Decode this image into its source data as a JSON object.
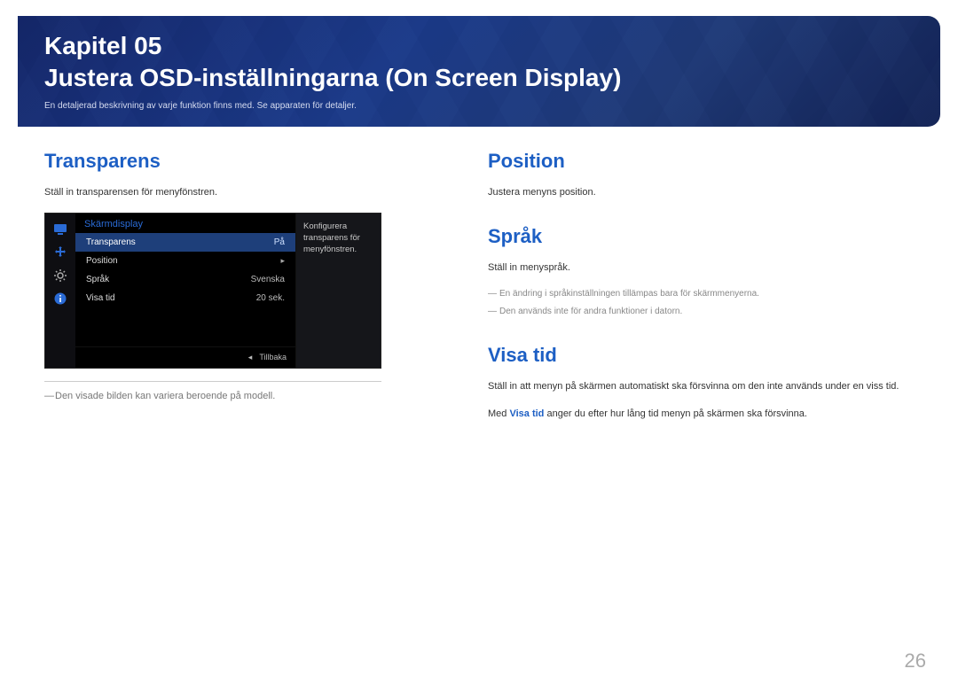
{
  "banner": {
    "chapter": "Kapitel 05",
    "title": "Justera OSD-inställningarna (On Screen Display)",
    "subtitle": "En detaljerad beskrivning av varje funktion finns med. Se apparaten för detaljer."
  },
  "left": {
    "heading": "Transparens",
    "desc": "Ställ in transparensen för menyfönstren.",
    "osd": {
      "header": "Skärmdisplay",
      "rows": [
        {
          "label": "Transparens",
          "value": "På",
          "selected": true
        },
        {
          "label": "Position",
          "value": "",
          "chevron": true
        },
        {
          "label": "Språk",
          "value": "Svenska"
        },
        {
          "label": "Visa tid",
          "value": "20 sek."
        }
      ],
      "side_tip": "Konfigurera transparens för menyfönstren.",
      "footer_back": "Tillbaka",
      "icons": [
        "monitor",
        "move",
        "gear",
        "info"
      ]
    },
    "footnote": "Den visade bilden kan variera beroende på modell."
  },
  "right": {
    "position": {
      "heading": "Position",
      "desc": "Justera menyns position."
    },
    "sprak": {
      "heading": "Språk",
      "desc": "Ställ in menyspråk.",
      "hint1": "En ändring i språkinställningen tillämpas bara för skärmmenyerna.",
      "hint2": "Den används inte för andra funktioner i datorn."
    },
    "visatid": {
      "heading": "Visa tid",
      "desc": "Ställ in att menyn på skärmen automatiskt ska försvinna om den inte används under en viss tid.",
      "desc2_pre": "Med ",
      "desc2_emph": "Visa tid",
      "desc2_post": " anger du efter hur lång tid menyn på skärmen ska försvinna."
    }
  },
  "page_number": "26"
}
